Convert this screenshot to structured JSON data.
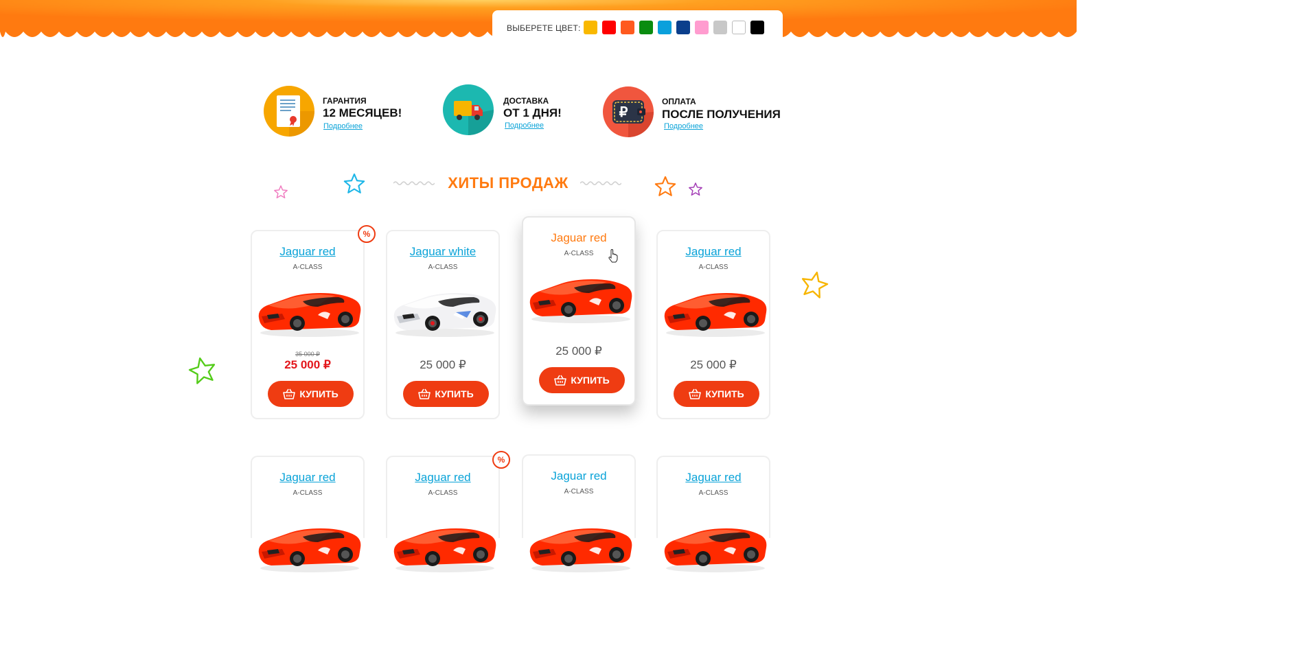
{
  "color_picker": {
    "label": "ВЫБЕРЕТЕ ЦВЕТ:",
    "swatches": [
      {
        "name": "yellow",
        "color": "#f9b800"
      },
      {
        "name": "red",
        "color": "#ff0000"
      },
      {
        "name": "orange",
        "color": "#ff5a1f"
      },
      {
        "name": "green",
        "color": "#0a8c10"
      },
      {
        "name": "light-blue",
        "color": "#0aa0dc"
      },
      {
        "name": "dark-blue",
        "color": "#0b3f8c"
      },
      {
        "name": "pink",
        "color": "#ff9ccf"
      },
      {
        "name": "gray",
        "color": "#c8c8c8"
      },
      {
        "name": "white",
        "color": "#ffffff"
      },
      {
        "name": "black",
        "color": "#000000"
      }
    ]
  },
  "features": [
    {
      "icon": "certificate-icon",
      "title": "ГАРАНТИЯ",
      "text": "12 МЕСЯЦЕВ!",
      "link": "Подробнее"
    },
    {
      "icon": "truck-icon",
      "title": "ДОСТАВКА",
      "text": "ОТ 1 ДНЯ!",
      "link": "Подробнее"
    },
    {
      "icon": "wallet-icon",
      "title": "ОПЛАТА",
      "text": "ПОСЛЕ ПОЛУЧЕНИЯ",
      "link": "Подробнее"
    }
  ],
  "section_title": "ХИТЫ ПРОДАЖ",
  "products": [
    {
      "title": "Jaguar red",
      "subtitle": "A-CLASS",
      "old_price": "35 000 ₽",
      "price": "25 000 ₽",
      "buy": "КУПИТЬ",
      "badge": "%",
      "car_color": "red"
    },
    {
      "title": "Jaguar white",
      "subtitle": "A-CLASS",
      "price": "25 000 ₽",
      "buy": "КУПИТЬ",
      "car_color": "white"
    },
    {
      "title": "Jaguar red",
      "subtitle": "A-CLASS",
      "price": "25 000 ₽",
      "buy": "КУПИТЬ",
      "car_color": "red",
      "hovered": true
    },
    {
      "title": "Jaguar red",
      "subtitle": "A-CLASS",
      "price": "25 000 ₽",
      "buy": "КУПИТЬ",
      "car_color": "red"
    },
    {
      "title": "Jaguar red",
      "subtitle": "A-CLASS",
      "car_color": "red"
    },
    {
      "title": "Jaguar red",
      "subtitle": "A-CLASS",
      "badge": "%",
      "car_color": "red"
    },
    {
      "title": "Jaguar red",
      "subtitle": "A-CLASS",
      "car_color": "red"
    },
    {
      "title": "Jaguar red",
      "subtitle": "A-CLASS",
      "car_color": "red"
    }
  ],
  "colors": {
    "accent_orange": "#ff7a10",
    "buy_button": "#ef3c12",
    "link_blue": "#0aa3d8",
    "sale_red": "#e3171c"
  }
}
